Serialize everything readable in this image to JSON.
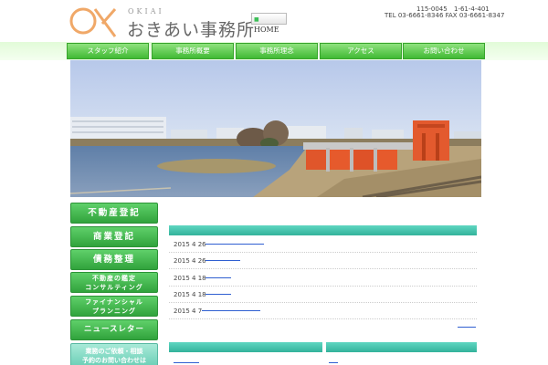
{
  "header": {
    "logo_sub": "OKIAI",
    "logo_title": "おきあい事務所",
    "home_label": "HOME",
    "contact_postal": "115-0045",
    "contact_address": "1-61-4-401",
    "contact_tel": "TEL 03-6661-8346 FAX 03-6661-8347"
  },
  "nav": {
    "items": [
      {
        "label": "スタッフ紹介"
      },
      {
        "label": "事務所概要"
      },
      {
        "label": "事務所理念"
      },
      {
        "label": "アクセス"
      },
      {
        "label": "お問い合わせ"
      }
    ]
  },
  "sidebar": {
    "items": [
      {
        "line1": "不動産登記"
      },
      {
        "line1": "商業登記"
      },
      {
        "line1": "債務整理"
      },
      {
        "line1": "不動産の鑑定",
        "line2": "コンサルティング"
      },
      {
        "line1": "ファイナンシャル",
        "line2": "プランニング"
      },
      {
        "line1": "ニュースレター"
      }
    ],
    "contact": {
      "line1": "業務のご依頼・相談",
      "line2": "予約のお問い合わせは"
    }
  },
  "news": {
    "items": [
      {
        "date": "2015 4 26"
      },
      {
        "date": "2015 4 26"
      },
      {
        "date": "2015 4 18"
      },
      {
        "date": "2015 4 18"
      },
      {
        "date": "2015 4 7"
      }
    ]
  },
  "colors": {
    "nav_green": "#41b934",
    "sidebar_green": "#31a33c",
    "panel_teal": "#33b29b",
    "link_blue": "#2f5fd1",
    "logo_orange": "#f0a868"
  },
  "hero": {
    "description_icon": "river-sluice-gate-photo"
  }
}
